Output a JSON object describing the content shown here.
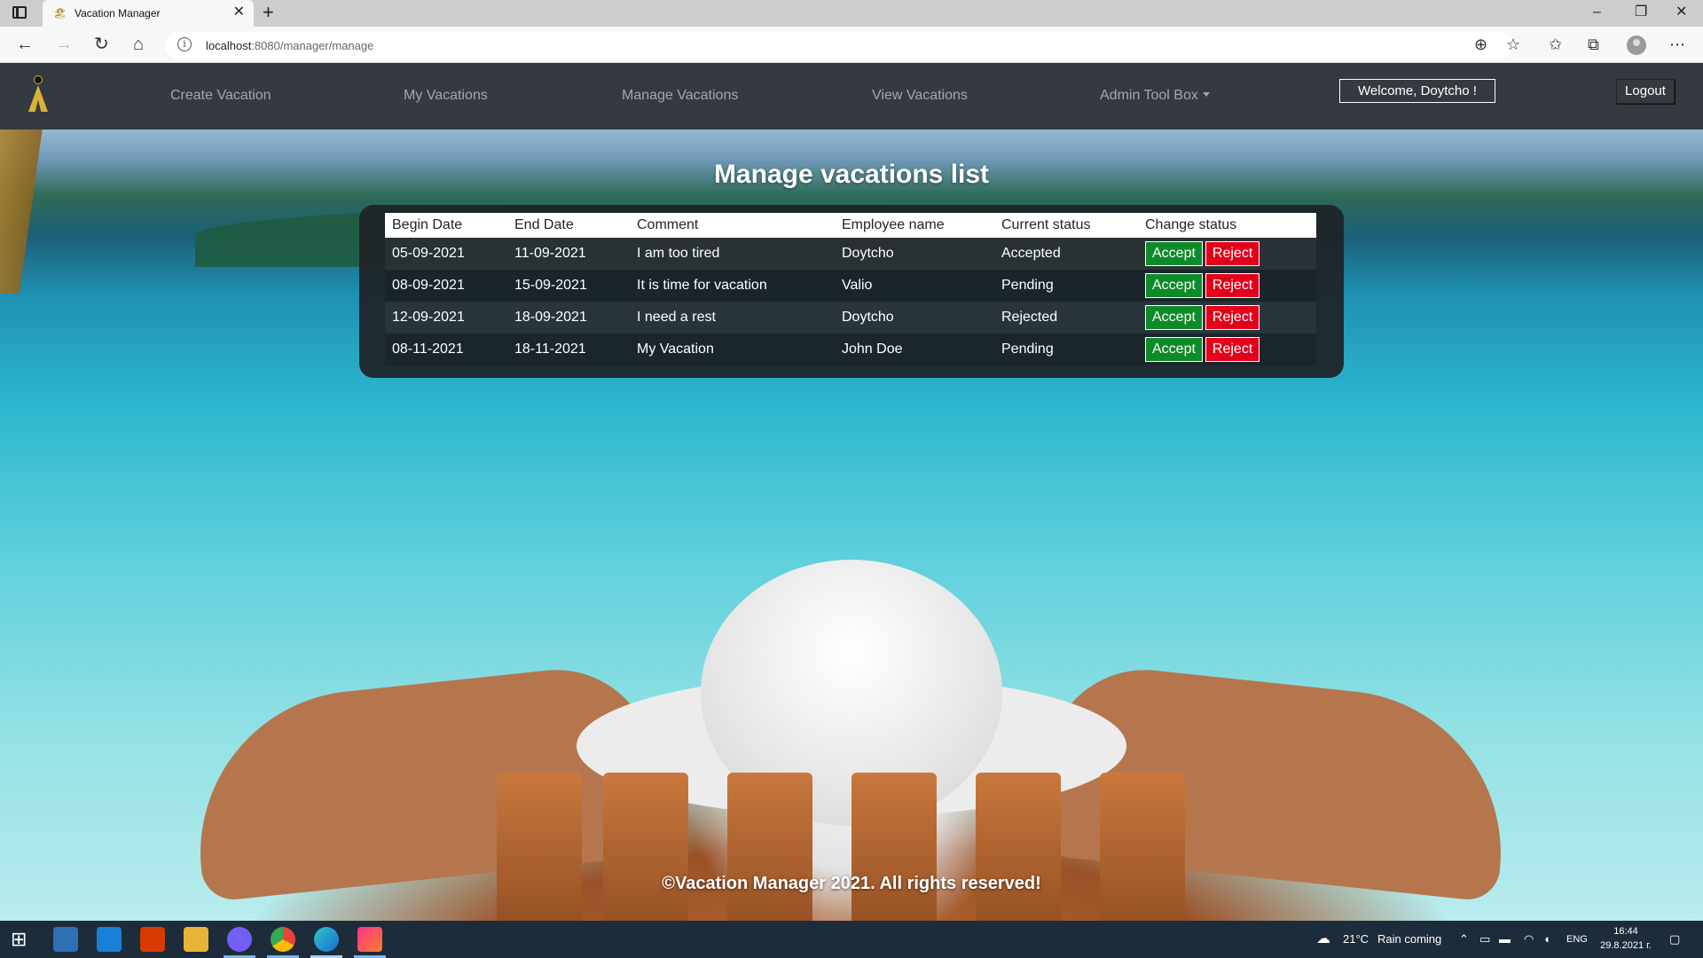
{
  "browser": {
    "tab_title": "Vacation Manager",
    "url_host": "localhost",
    "url_path": ":8080/manager/manage",
    "favicon": "vacation-logo-icon"
  },
  "navbar": {
    "links": [
      "Create Vacation",
      "My Vacations",
      "Manage Vacations",
      "View Vacations",
      "Admin Tool Box"
    ],
    "welcome": "Welcome, Doytcho !",
    "logout": "Logout"
  },
  "page": {
    "title": "Manage vacations list",
    "footer": "©Vacation Manager 2021. All rights reserved!"
  },
  "table": {
    "headers": [
      "Begin Date",
      "End Date",
      "Comment",
      "Employee name",
      "Current status",
      "Change status"
    ],
    "rows": [
      {
        "begin": "05-09-2021",
        "end": "11-09-2021",
        "comment": "I am too tired",
        "employee": "Doytcho",
        "status": "Accepted"
      },
      {
        "begin": "08-09-2021",
        "end": "15-09-2021",
        "comment": "It is time for vacation",
        "employee": "Valio",
        "status": "Pending"
      },
      {
        "begin": "12-09-2021",
        "end": "18-09-2021",
        "comment": "I need a rest",
        "employee": "Doytcho",
        "status": "Rejected"
      },
      {
        "begin": "08-11-2021",
        "end": "18-11-2021",
        "comment": "My Vacation",
        "employee": "John Doe",
        "status": "Pending"
      }
    ],
    "accept_label": "Accept",
    "reject_label": "Reject"
  },
  "taskbar": {
    "weather": "21°C",
    "weather_text": "Rain coming",
    "language": "ENG",
    "time": "16:44",
    "date": "29.8.2021 г."
  },
  "colors": {
    "navbar": "#343a40",
    "accept": "#0f8a2a",
    "reject": "#e3001b"
  }
}
